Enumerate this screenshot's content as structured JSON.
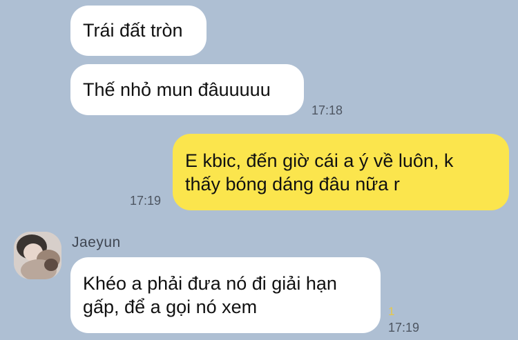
{
  "messages": {
    "m1": {
      "text": "Trái đất tròn"
    },
    "m2": {
      "text": "Thế nhỏ mun đâuuuuu",
      "time": "17:18"
    },
    "m3": {
      "line1": "E kbic, đến giờ cái a ý về luôn, k",
      "line2": "thấy bóng dáng đâu nữa r",
      "time": "17:19"
    },
    "m4": {
      "sender": "Jaeyun",
      "line1": "Khéo a phải đưa nó đi giải hạn",
      "line2": "gấp, để a gọi nó xem",
      "read_count": "1",
      "time": "17:19"
    }
  },
  "colors": {
    "background": "#aebfd3",
    "incoming_bubble": "#ffffff",
    "outgoing_bubble": "#fbe54d",
    "read_counter": "#e6c84a"
  },
  "icons": {
    "avatar": "user-avatar"
  }
}
